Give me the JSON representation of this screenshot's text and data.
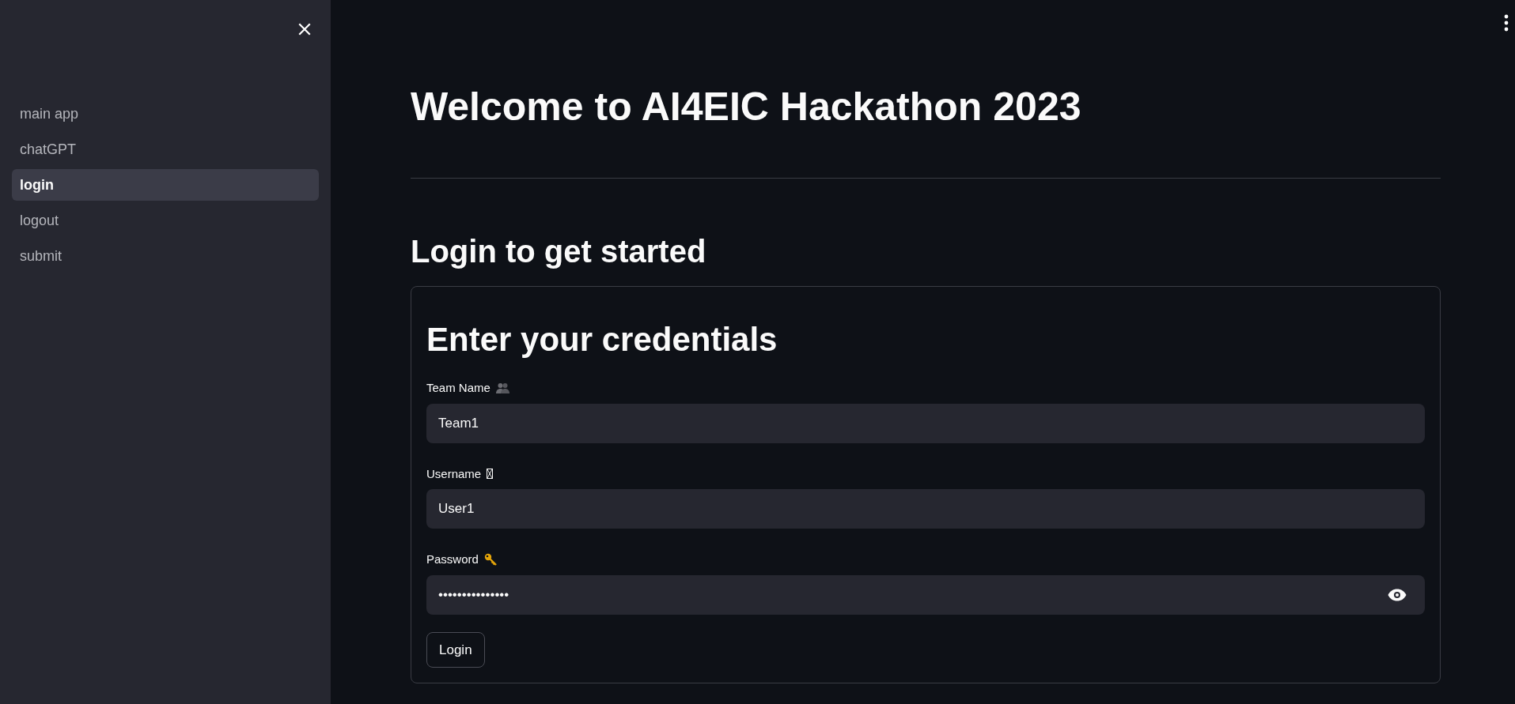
{
  "sidebar": {
    "items": [
      {
        "label": "main app",
        "selected": false
      },
      {
        "label": "chatGPT",
        "selected": false
      },
      {
        "label": "login",
        "selected": true
      },
      {
        "label": "logout",
        "selected": false
      },
      {
        "label": "submit",
        "selected": false
      }
    ]
  },
  "title": "Welcome to AI4EIC Hackathon 2023",
  "subtitle": "Login to get started",
  "form": {
    "heading": "Enter your credentials",
    "fields": [
      {
        "label": "Team Name",
        "value": "Team1",
        "kind": "text"
      },
      {
        "label": "Username",
        "value": "User1",
        "kind": "text"
      },
      {
        "label": "Password",
        "value": "•••••••••••••••",
        "kind": "password"
      }
    ],
    "button": "Login"
  }
}
